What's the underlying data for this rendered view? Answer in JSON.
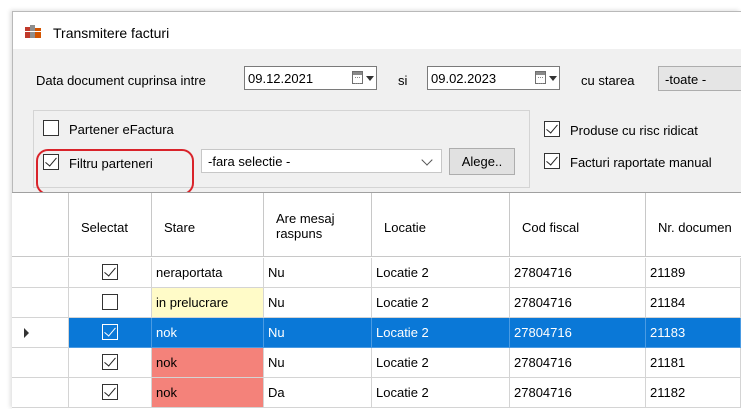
{
  "window": {
    "title": "Transmitere facturi",
    "icon": "invoice-app-icon"
  },
  "filter": {
    "date_label": "Data document cuprinsa intre",
    "date_from": "09.12.2021",
    "and_label": "si",
    "date_to": "09.02.2023",
    "state_label": "cu starea",
    "state_value": "-toate -"
  },
  "options": {
    "partener_efactura": {
      "label": "Partener eFactura",
      "checked": false
    },
    "filtru_parteneri": {
      "label": "Filtru parteneri",
      "checked": true
    },
    "partner_select_value": "-fara selectie -",
    "choose_button": "Alege..",
    "produse_risc": {
      "label": "Produse cu risc ridicat",
      "checked": true
    },
    "facturi_raportate": {
      "label": "Facturi raportate manual",
      "checked": true
    }
  },
  "grid": {
    "columns": [
      "Selectat",
      "Stare",
      "Are mesaj raspuns",
      "Locatie",
      "Cod fiscal",
      "Nr. documen"
    ],
    "rows": [
      {
        "selectat": true,
        "stare": "neraportata",
        "mesaj": "Nu",
        "locatie": "Locatie 2",
        "cod_fiscal": "27804716",
        "nr_doc": "21189",
        "current": false
      },
      {
        "selectat": false,
        "stare": "in prelucrare",
        "mesaj": "Nu",
        "locatie": "Locatie 2",
        "cod_fiscal": "27804716",
        "nr_doc": "21184",
        "current": false
      },
      {
        "selectat": true,
        "stare": "nok",
        "mesaj": "Nu",
        "locatie": "Locatie 2",
        "cod_fiscal": "27804716",
        "nr_doc": "21183",
        "current": true
      },
      {
        "selectat": true,
        "stare": "nok",
        "mesaj": "Nu",
        "locatie": "Locatie 2",
        "cod_fiscal": "27804716",
        "nr_doc": "21181",
        "current": false
      },
      {
        "selectat": true,
        "stare": "nok",
        "mesaj": "Da",
        "locatie": "Locatie 2",
        "cod_fiscal": "27804716",
        "nr_doc": "21182",
        "current": false
      }
    ],
    "status_colors": {
      "in prelucrare": "#fffbc8",
      "nok": "#f4827a"
    },
    "selection_color": "#0a78d7"
  },
  "annotation": {
    "highlight_color": "#d9232a"
  }
}
